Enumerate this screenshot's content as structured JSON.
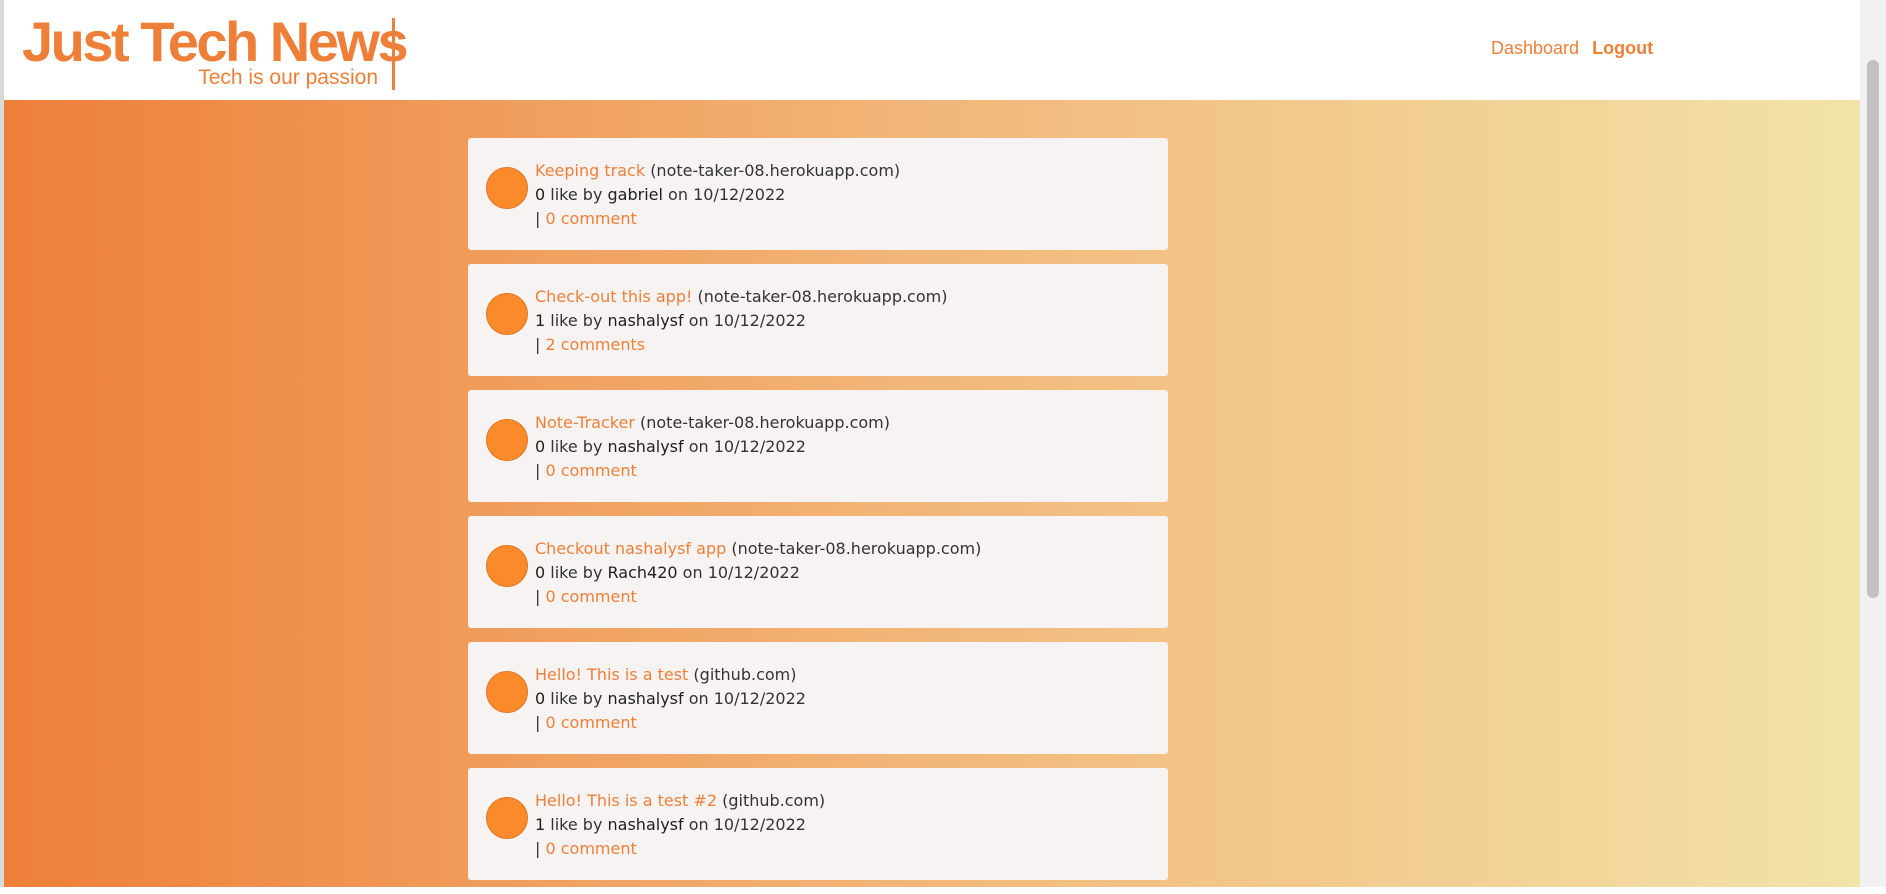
{
  "header": {
    "title": "Just Tech News",
    "tagline": "Tech is our passion",
    "nav": {
      "dashboard": "Dashboard",
      "logout": "Logout"
    }
  },
  "posts": [
    {
      "title": "Keeping track",
      "domain": "(note-taker-08.herokuapp.com)",
      "likes": "0",
      "like_word": "like by",
      "author": "gabriel",
      "on_word": "on",
      "date": "10/12/2022",
      "comments": "0 comment"
    },
    {
      "title": "Check-out this app!",
      "domain": "(note-taker-08.herokuapp.com)",
      "likes": "1",
      "like_word": "like by",
      "author": "nashalysf",
      "on_word": "on",
      "date": "10/12/2022",
      "comments": "2 comments"
    },
    {
      "title": "Note-Tracker",
      "domain": "(note-taker-08.herokuapp.com)",
      "likes": "0",
      "like_word": "like by",
      "author": "nashalysf",
      "on_word": "on",
      "date": "10/12/2022",
      "comments": "0 comment"
    },
    {
      "title": "Checkout nashalysf app",
      "domain": "(note-taker-08.herokuapp.com)",
      "likes": "0",
      "like_word": "like by",
      "author": "Rach420",
      "on_word": "on",
      "date": "10/12/2022",
      "comments": "0 comment"
    },
    {
      "title": "Hello! This is a test",
      "domain": "(github.com)",
      "likes": "0",
      "like_word": "like by",
      "author": "nashalysf",
      "on_word": "on",
      "date": "10/12/2022",
      "comments": "0 comment"
    },
    {
      "title": "Hello! This is a test #2",
      "domain": "(github.com)",
      "likes": "1",
      "like_word": "like by",
      "author": "nashalysf",
      "on_word": "on",
      "date": "10/12/2022",
      "comments": "0 comment"
    }
  ],
  "colors": {
    "accent": "#ee7f39",
    "avatar": "#fb8a2a",
    "card": "#f7f3f2",
    "gradient_start": "#ee7f39",
    "gradient_end": "#f2e3a8"
  },
  "icons": {
    "avatar": "avatar-circle-icon"
  }
}
